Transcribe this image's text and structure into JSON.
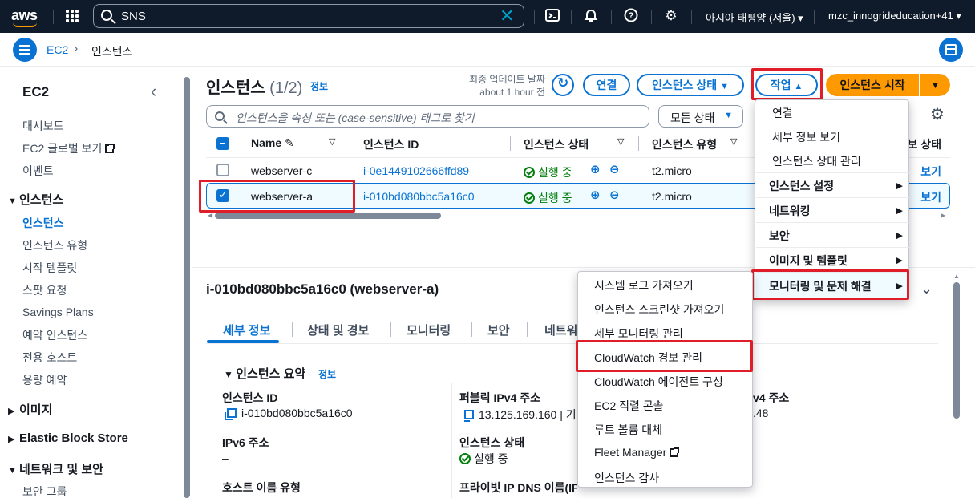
{
  "topnav": {
    "logo": "aws",
    "search_value": "SNS",
    "region": "아시아 태평양 (서울)",
    "account": "mzc_innogrideducation+41",
    "icons": [
      "grid-icon",
      "search-icon",
      "clear-icon",
      "cloudshell-icon",
      "bell-icon",
      "help-icon",
      "gear-icon"
    ]
  },
  "breadcrumb": {
    "root": "EC2",
    "current": "인스턴스"
  },
  "sidebar": {
    "title": "EC2",
    "top_items": [
      "대시보드",
      "EC2 글로벌 보기",
      "이벤트"
    ],
    "sections": [
      {
        "label": "인스턴스",
        "expanded": true,
        "items": [
          "인스턴스",
          "인스턴스 유형",
          "시작 템플릿",
          "스팟 요청",
          "Savings Plans",
          "예약 인스턴스",
          "전용 호스트",
          "용량 예약"
        ]
      },
      {
        "label": "이미지",
        "expanded": false
      },
      {
        "label": "Elastic Block Store",
        "expanded": false
      },
      {
        "label": "네트워크 및 보안",
        "expanded": true,
        "items": [
          "보안 그룹"
        ]
      }
    ]
  },
  "list": {
    "title": "인스턴스",
    "count": "(1/2)",
    "info": "정보",
    "last_updated_label": "최종 업데이트 날짜",
    "last_updated_value": "about 1 hour 전",
    "buttons": {
      "connect": "연결",
      "state": "인스턴스 상태",
      "actions": "작업",
      "launch": "인스턴스 시작"
    },
    "filter_placeholder": "인스턴스을 속성 또는 (case-sensitive) 태그로 찾기",
    "status_filter": "모든 상태",
    "columns": [
      "Name",
      "인스턴스 ID",
      "인스턴스 상태",
      "인스턴스 유형",
      "경보 상태"
    ],
    "rows": [
      {
        "name": "webserver-c",
        "id": "i-0e1449102666ffd89",
        "state": "실행 중",
        "type": "t2.micro",
        "alarm": "보기",
        "selected": false
      },
      {
        "name": "webserver-a",
        "id": "i-010bd080bbc5a16c0",
        "state": "실행 중",
        "type": "t2.micro",
        "alarm": "보기",
        "selected": true
      }
    ]
  },
  "detail": {
    "title": "i-010bd080bbc5a16c0 (webserver-a)",
    "tabs": [
      "세부 정보",
      "상태 및 경보",
      "모니터링",
      "보안",
      "네트워"
    ],
    "summary_title": "인스턴스 요약",
    "summary_info": "정보",
    "fields": {
      "instance_id_label": "인스턴스 ID",
      "instance_id": "i-010bd080bbc5a16c0",
      "public_ip_label": "퍼블릭 IPv4 주소",
      "public_ip": "13.125.169.160 | 기",
      "private_ip_label": "v4 주소",
      "private_ip": ".48",
      "ipv6_label": "IPv6 주소",
      "ipv6": "–",
      "state_label": "인스턴스 상태",
      "state": "실행 중",
      "host_type_label": "호스트 이름 유형",
      "private_dns_label": "프라이빗 IP DNS 이름(IP"
    }
  },
  "action_menu": {
    "items": [
      "연결",
      "세부 정보 보기",
      "인스턴스 상태 관리"
    ],
    "groups": [
      "인스턴스 설정",
      "네트워킹",
      "보안",
      "이미지 및 템플릿",
      "모니터링 및 문제 해결"
    ]
  },
  "submenu": {
    "items": [
      "시스템 로그 가져오기",
      "인스턴스 스크린샷 가져오기",
      "세부 모니터링 관리",
      "CloudWatch 경보 관리",
      "CloudWatch 에이전트 구성",
      "EC2 직렬 콘솔",
      "루트 볼륨 대체",
      "Fleet Manager",
      "인스턴스 감사"
    ]
  },
  "colors": {
    "accent": "#0972d3",
    "primary_button": "#ff9900",
    "nav_bg": "#0f1b2a",
    "highlight": "#e01e29",
    "success": "#037f0c"
  }
}
